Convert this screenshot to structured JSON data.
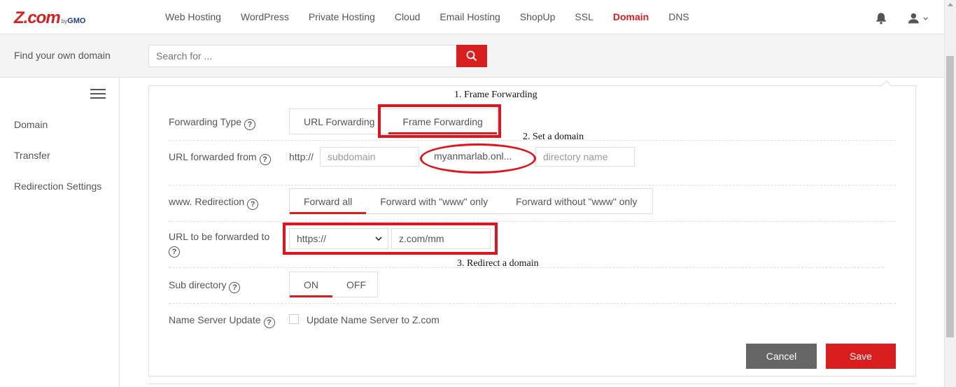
{
  "header": {
    "logo_main": "Z.com",
    "logo_by": "by",
    "logo_gmo": "GMO",
    "nav": [
      "Web Hosting",
      "WordPress",
      "Private Hosting",
      "Cloud",
      "Email Hosting",
      "ShopUp",
      "SSL",
      "Domain",
      "DNS"
    ],
    "active_nav": "Domain"
  },
  "search": {
    "label": "Find your own domain",
    "placeholder": "Search for ..."
  },
  "sidebar": {
    "items": [
      "Domain",
      "Transfer",
      "Redirection Settings"
    ]
  },
  "form": {
    "forwarding_type": {
      "label": "Forwarding Type",
      "options": [
        "URL Forwarding",
        "Frame Forwarding"
      ],
      "selected": "Frame Forwarding"
    },
    "url_from": {
      "label": "URL forwarded from",
      "prefix": "http://",
      "subdomain_placeholder": "subdomain",
      "domain_value": "myanmarlab.onl...",
      "directory_placeholder": "directory name"
    },
    "www_redirection": {
      "label": "www. Redirection",
      "options": [
        "Forward all",
        "Forward with \"www\" only",
        "Forward without \"www\" only"
      ],
      "selected": "Forward all"
    },
    "url_to": {
      "label": "URL to be forwarded to",
      "protocol": "https://",
      "value": "z.com/mm"
    },
    "sub_directory": {
      "label": "Sub directory",
      "options": [
        "ON",
        "OFF"
      ],
      "selected": "ON"
    },
    "name_server": {
      "label": "Name Server Update",
      "checkbox_label": "Update Name Server to Z.com",
      "checked": false
    },
    "cancel_label": "Cancel",
    "save_label": "Save"
  },
  "annotations": {
    "step1": "1. Frame Forwarding",
    "step2": "2. Set a domain",
    "step3": "3. Redirect a domain"
  },
  "colors": {
    "brand_red": "#d81e1e",
    "annotation_red": "#e3131b",
    "cancel_gray": "#666666"
  }
}
